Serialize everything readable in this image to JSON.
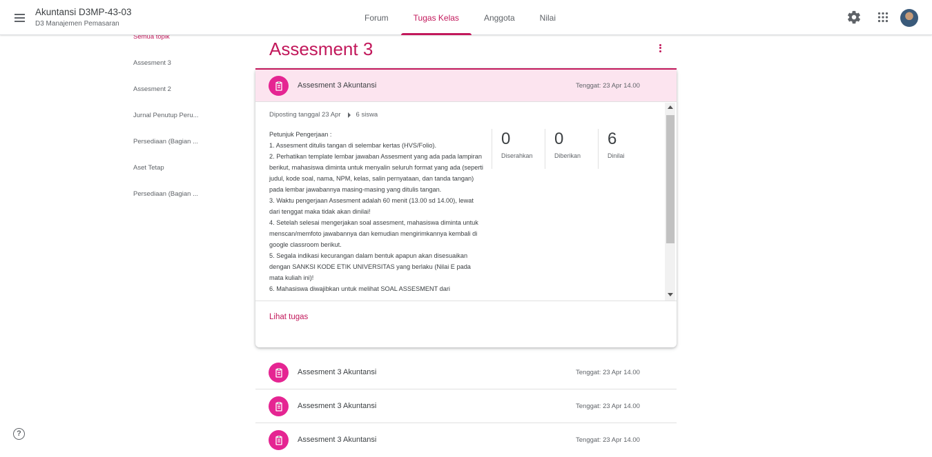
{
  "header": {
    "class_title": "Akuntansi D3MP-43-03",
    "class_subtitle": "D3 Manajemen Pemasaran",
    "tabs": [
      {
        "label": "Forum"
      },
      {
        "label": "Tugas Kelas"
      },
      {
        "label": "Anggota"
      },
      {
        "label": "Nilai"
      }
    ],
    "active_tab": "Tugas Kelas",
    "icons": [
      "settings-icon",
      "apps-grid-icon",
      "avatar"
    ]
  },
  "sidebar": {
    "items": [
      {
        "label": "Semua topik"
      },
      {
        "label": "Assesment 3"
      },
      {
        "label": "Assesment 2"
      },
      {
        "label": "Jurnal Penutup Peru..."
      },
      {
        "label": "Persediaan (Bagian ..."
      },
      {
        "label": "Aset Tetap"
      },
      {
        "label": "Persediaan (Bagian ..."
      }
    ]
  },
  "topic": {
    "title": "Assesment 3"
  },
  "expanded_assignment": {
    "title": "Assesment 3 Akuntansi",
    "due": "Tenggat: 23 Apr 14.00",
    "posted": "Diposting tanggal 23 Apr",
    "assigned": "6 siswa",
    "instructions": [
      "Petunjuk Pengerjaan :",
      "1. Assesment ditulis tangan di selembar kertas (HVS/Folio).",
      "2. Perhatikan template lembar jawaban Assesment yang ada pada lampiran berikut, mahasiswa diminta untuk menyalin seluruh format yang ada (seperti judul, kode soal, nama, NPM, kelas, salin pernyataan, dan tanda tangan) pada lembar jawabannya masing-masing yang ditulis tangan.",
      "3. Waktu pengerjaan Assesment adalah 60 menit (13.00 sd 14.00), lewat dari tenggat maka tidak akan dinilai!",
      "4. Setelah selesai mengerjakan soal assesment, mahasiswa diminta untuk menscan/memfoto jawabannya dan kemudian mengirimkannya kembali di google classroom berikut.",
      "5. Segala indikasi kecurangan dalam bentuk apapun akan disesuaikan dengan SANKSI KODE ETIK UNIVERSITAS yang berlaku (Nilai E pada mata kuliah ini)!",
      "6. Mahasiswa diwajibkan untuk melihat SOAL ASSESMENT dari"
    ],
    "stats": [
      {
        "value": "0",
        "label": "Diserahkan"
      },
      {
        "value": "0",
        "label": "Diberikan"
      },
      {
        "value": "6",
        "label": "Dinilai"
      }
    ],
    "view_link": "Lihat tugas"
  },
  "assignments": [
    {
      "title": "Assesment 3 Akuntansi",
      "due": "Tenggat: 23 Apr 14.00"
    },
    {
      "title": "Assesment 3 Akuntansi",
      "due": "Tenggat: 23 Apr 14.00"
    },
    {
      "title": "Assesment 3 Akuntansi",
      "due": "Tenggat: 23 Apr 14.00"
    }
  ],
  "help": "?",
  "colors": {
    "accent": "#c2185b",
    "assignment_icon_bg": "#e52592",
    "highlight_bg": "#fce4ef"
  }
}
